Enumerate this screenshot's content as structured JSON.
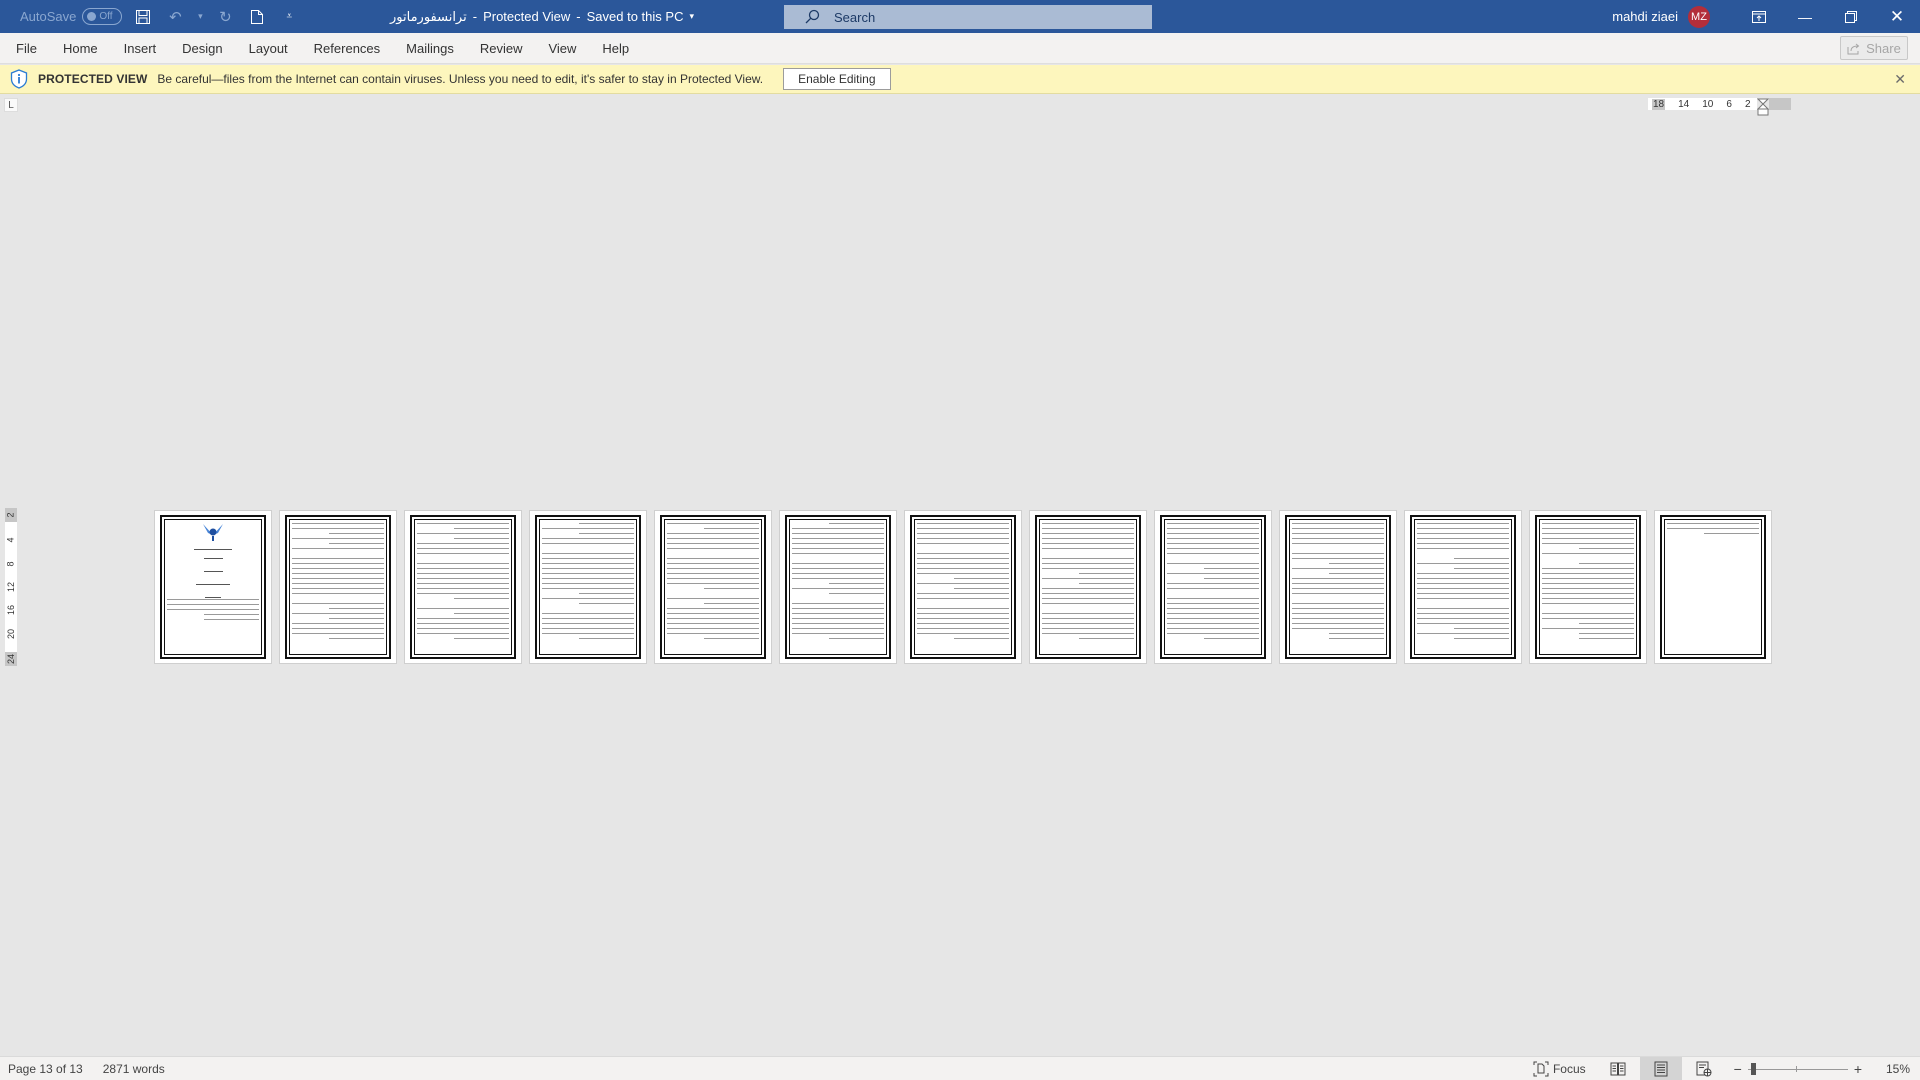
{
  "titlebar": {
    "autosave_label": "AutoSave",
    "autosave_state": "Off",
    "doc_name": "ترانسفورماتور",
    "separator": "-",
    "view_mode": "Protected View",
    "save_status": "Saved to this PC",
    "search_placeholder": "Search",
    "user_name": "mahdi ziaei",
    "user_initials": "MZ",
    "colors": {
      "bar": "#2b579a",
      "avatar": "#b32e3a"
    }
  },
  "ribbon": {
    "tabs": [
      "File",
      "Home",
      "Insert",
      "Design",
      "Layout",
      "References",
      "Mailings",
      "Review",
      "View",
      "Help"
    ],
    "share_label": "Share"
  },
  "protected_view": {
    "label": "PROTECTED VIEW",
    "message": "Be careful—files from the Internet can contain viruses. Unless you need to edit, it's safer to stay in Protected View.",
    "button_label": "Enable Editing",
    "color": "#fdf6bd"
  },
  "rulers": {
    "horizontal_ticks": [
      "18",
      "14",
      "10",
      "6",
      "2"
    ],
    "vertical_ticks": [
      "2",
      "4",
      "8",
      "12",
      "16",
      "20",
      "24"
    ],
    "tab_selector": "L"
  },
  "document": {
    "page_count": 13,
    "pages": [
      {
        "type": "cover"
      },
      {
        "type": "text"
      },
      {
        "type": "text"
      },
      {
        "type": "text"
      },
      {
        "type": "text"
      },
      {
        "type": "text"
      },
      {
        "type": "text"
      },
      {
        "type": "text"
      },
      {
        "type": "text"
      },
      {
        "type": "text"
      },
      {
        "type": "text"
      },
      {
        "type": "text"
      },
      {
        "type": "short"
      }
    ]
  },
  "statusbar": {
    "page_info": "Page 13 of 13",
    "word_count": "2871 words",
    "focus_label": "Focus",
    "zoom_percent": "15%",
    "zoom_value": 15
  }
}
